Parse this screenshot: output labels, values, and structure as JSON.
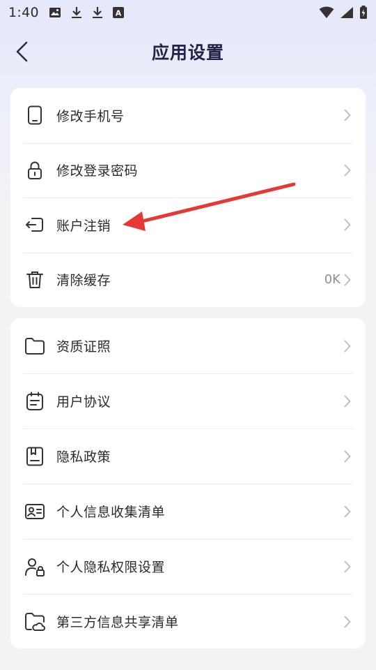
{
  "status_bar": {
    "time": "1:40",
    "left_icons": [
      "image-icon",
      "download-icon",
      "download-icon",
      "accessibility-a-icon"
    ],
    "right_icons": [
      "wifi-icon",
      "signal-icon",
      "battery-icon"
    ]
  },
  "header": {
    "title": "应用设置"
  },
  "group1": {
    "items": [
      {
        "label": "修改手机号",
        "icon": "phone-icon"
      },
      {
        "label": "修改登录密码",
        "icon": "lock-icon"
      },
      {
        "label": "账户注销",
        "icon": "logout-icon"
      },
      {
        "label": "清除缓存",
        "icon": "trash-icon",
        "value": "0K"
      }
    ]
  },
  "group2": {
    "items": [
      {
        "label": "资质证照",
        "icon": "folder-icon"
      },
      {
        "label": "用户协议",
        "icon": "document-icon"
      },
      {
        "label": "隐私政策",
        "icon": "privacy-book-icon"
      },
      {
        "label": "个人信息收集清单",
        "icon": "id-card-icon"
      },
      {
        "label": "个人隐私权限设置",
        "icon": "user-lock-icon"
      },
      {
        "label": "第三方信息共享清单",
        "icon": "cloud-folder-icon"
      }
    ]
  },
  "colors": {
    "annotation_arrow": "#e53935",
    "title": "#23234a",
    "chevron": "#bdbdc4"
  }
}
